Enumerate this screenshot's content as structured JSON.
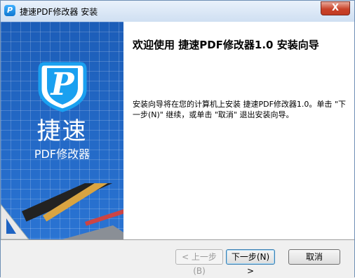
{
  "window": {
    "title": "捷速PDF修改器 安装",
    "close_label": "X"
  },
  "sidebar": {
    "brand_name": "捷速",
    "brand_subtitle": "PDF修改器",
    "logo_letter": "P"
  },
  "main": {
    "heading": "欢迎使用 捷速PDF修改器1.0 安装向导",
    "body": "安装向导将在您的计算机上安装 捷速PDF修改器1.0。单击 \"下一步(N)\" 继续，或单击 \"取消\" 退出安装向导。"
  },
  "buttons": {
    "back_label": "< 上一步(B)",
    "next_label": "下一步(N) >",
    "cancel_label": "取消"
  },
  "colors": {
    "sidebar_blue": "#1d63c2",
    "logo_ring": "#1aa0f0"
  }
}
